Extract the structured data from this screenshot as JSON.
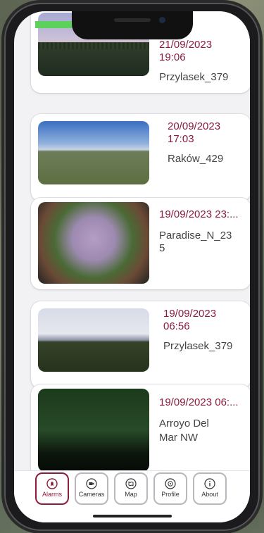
{
  "alarms": [
    {
      "date": "21/09/2023",
      "time": "19:06",
      "camera": "Przylasek_379"
    },
    {
      "date": "20/09/2023",
      "time": "17:03",
      "camera": "Raków_429"
    },
    {
      "date": "19/09/2023 23:...",
      "time": "",
      "camera": "Paradise_N_23",
      "camera_cont": "5"
    },
    {
      "date": "19/09/2023",
      "time": "06:56",
      "camera": "Przylasek_379"
    },
    {
      "date": "19/09/2023 06:...",
      "time": "",
      "camera": "Arroyo Del",
      "camera_cont": "Mar NW"
    }
  ],
  "tabs": [
    {
      "label": "Alarms",
      "icon": "bell-icon"
    },
    {
      "label": "Cameras",
      "icon": "video-camera-icon"
    },
    {
      "label": "Map",
      "icon": "map-icon"
    },
    {
      "label": "Profile",
      "icon": "profile-icon"
    },
    {
      "label": "About",
      "icon": "info-icon"
    }
  ],
  "colors": {
    "accent": "#8a1c3c",
    "text": "#444444",
    "status_battery": "#5cd15c"
  }
}
